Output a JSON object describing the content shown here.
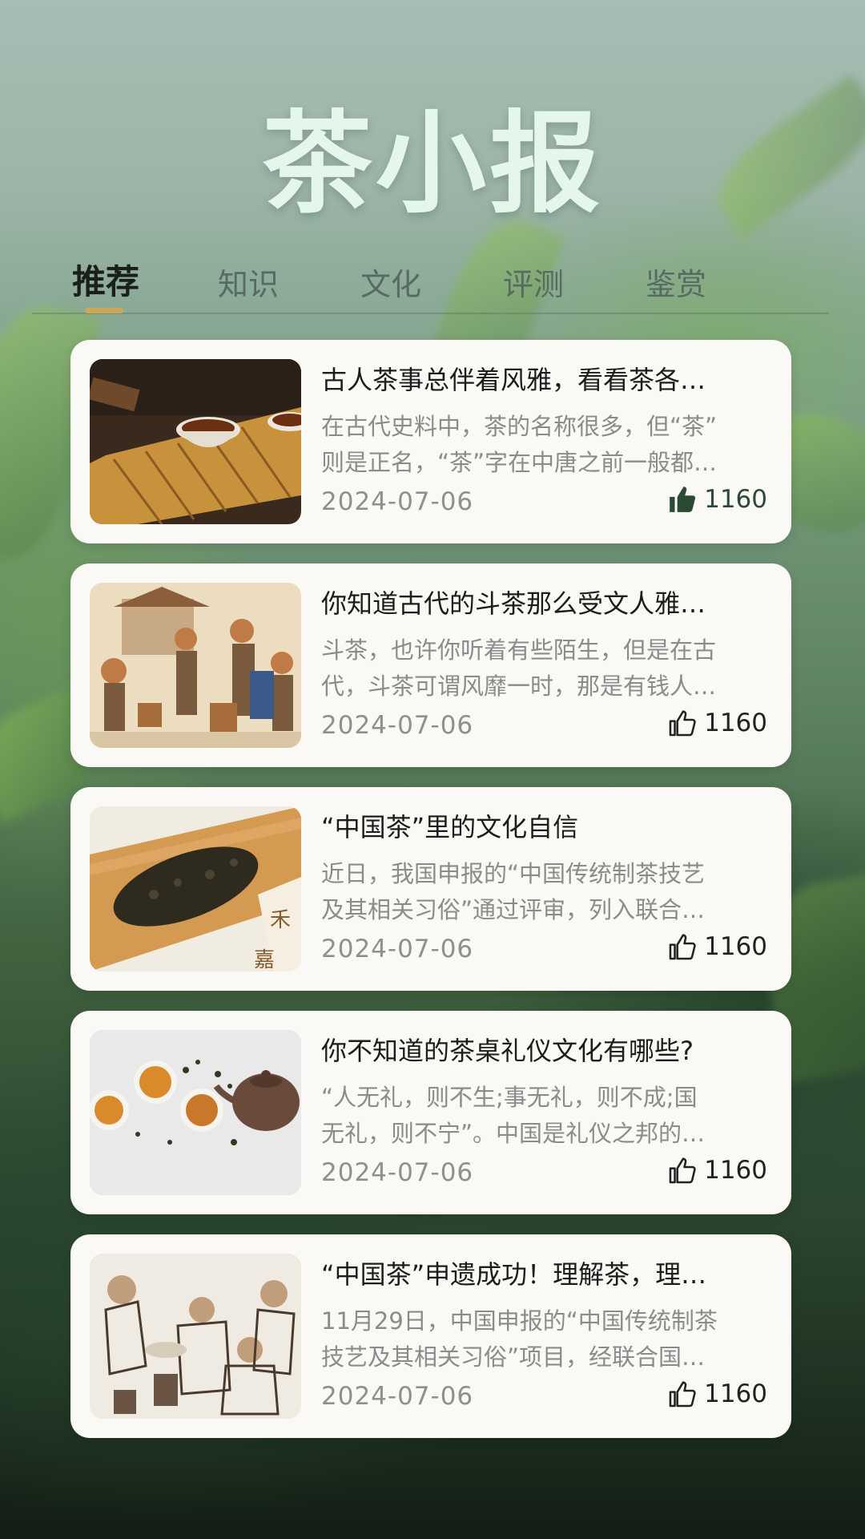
{
  "app": {
    "title": "茶小报"
  },
  "tabs": [
    {
      "label": "推荐",
      "active": true
    },
    {
      "label": "知识",
      "active": false
    },
    {
      "label": "文化",
      "active": false
    },
    {
      "label": "评测",
      "active": false
    },
    {
      "label": "鉴赏",
      "active": false
    }
  ],
  "colors": {
    "accent": "#c9a85c",
    "title": "#e4f7ea",
    "liked": "#2c4a32"
  },
  "articles": [
    {
      "title": "古人茶事总伴着风雅，看看茶各…",
      "summary_line1": "在古代史料中，茶的名称很多，但“茶”",
      "summary_line2": "则是正名，“茶”字在中唐之前一般都…",
      "date": "2024-07-06",
      "likes": "1160",
      "liked": true,
      "thumb_icon": "tea-cups-on-bamboo-mat-image"
    },
    {
      "title": "你知道古代的斗茶那么受文人雅…",
      "summary_line1": "斗茶，也许你听着有些陌生，但是在古",
      "summary_line2": "代，斗茶可谓风靡一时，那是有钱人…",
      "date": "2024-07-06",
      "likes": "1160",
      "liked": false,
      "thumb_icon": "ancient-tea-market-painting-image"
    },
    {
      "title": "“中国茶”里的文化自信",
      "summary_line1": "近日，我国申报的“中国传统制茶技艺",
      "summary_line2": "及其相关习俗”通过评审，列入联合…",
      "date": "2024-07-06",
      "likes": "1160",
      "liked": false,
      "thumb_icon": "loose-tea-leaves-tray-image"
    },
    {
      "title": "你不知道的茶桌礼仪文化有哪些?",
      "summary_line1": "“人无礼，则不生;事无礼，则不成;国",
      "summary_line2": "无礼，则不宁”。中国是礼仪之邦的…",
      "date": "2024-07-06",
      "likes": "1160",
      "liked": false,
      "thumb_icon": "teapot-and-cups-image"
    },
    {
      "title": "“中国茶”申遗成功！理解茶，理…",
      "summary_line1": "11月29日，中国申报的“中国传统制茶",
      "summary_line2": "技艺及其相关习俗”项目，经联合国…",
      "date": "2024-07-06",
      "likes": "1160",
      "liked": false,
      "thumb_icon": "ancient-tea-gathering-sketch-image"
    }
  ]
}
